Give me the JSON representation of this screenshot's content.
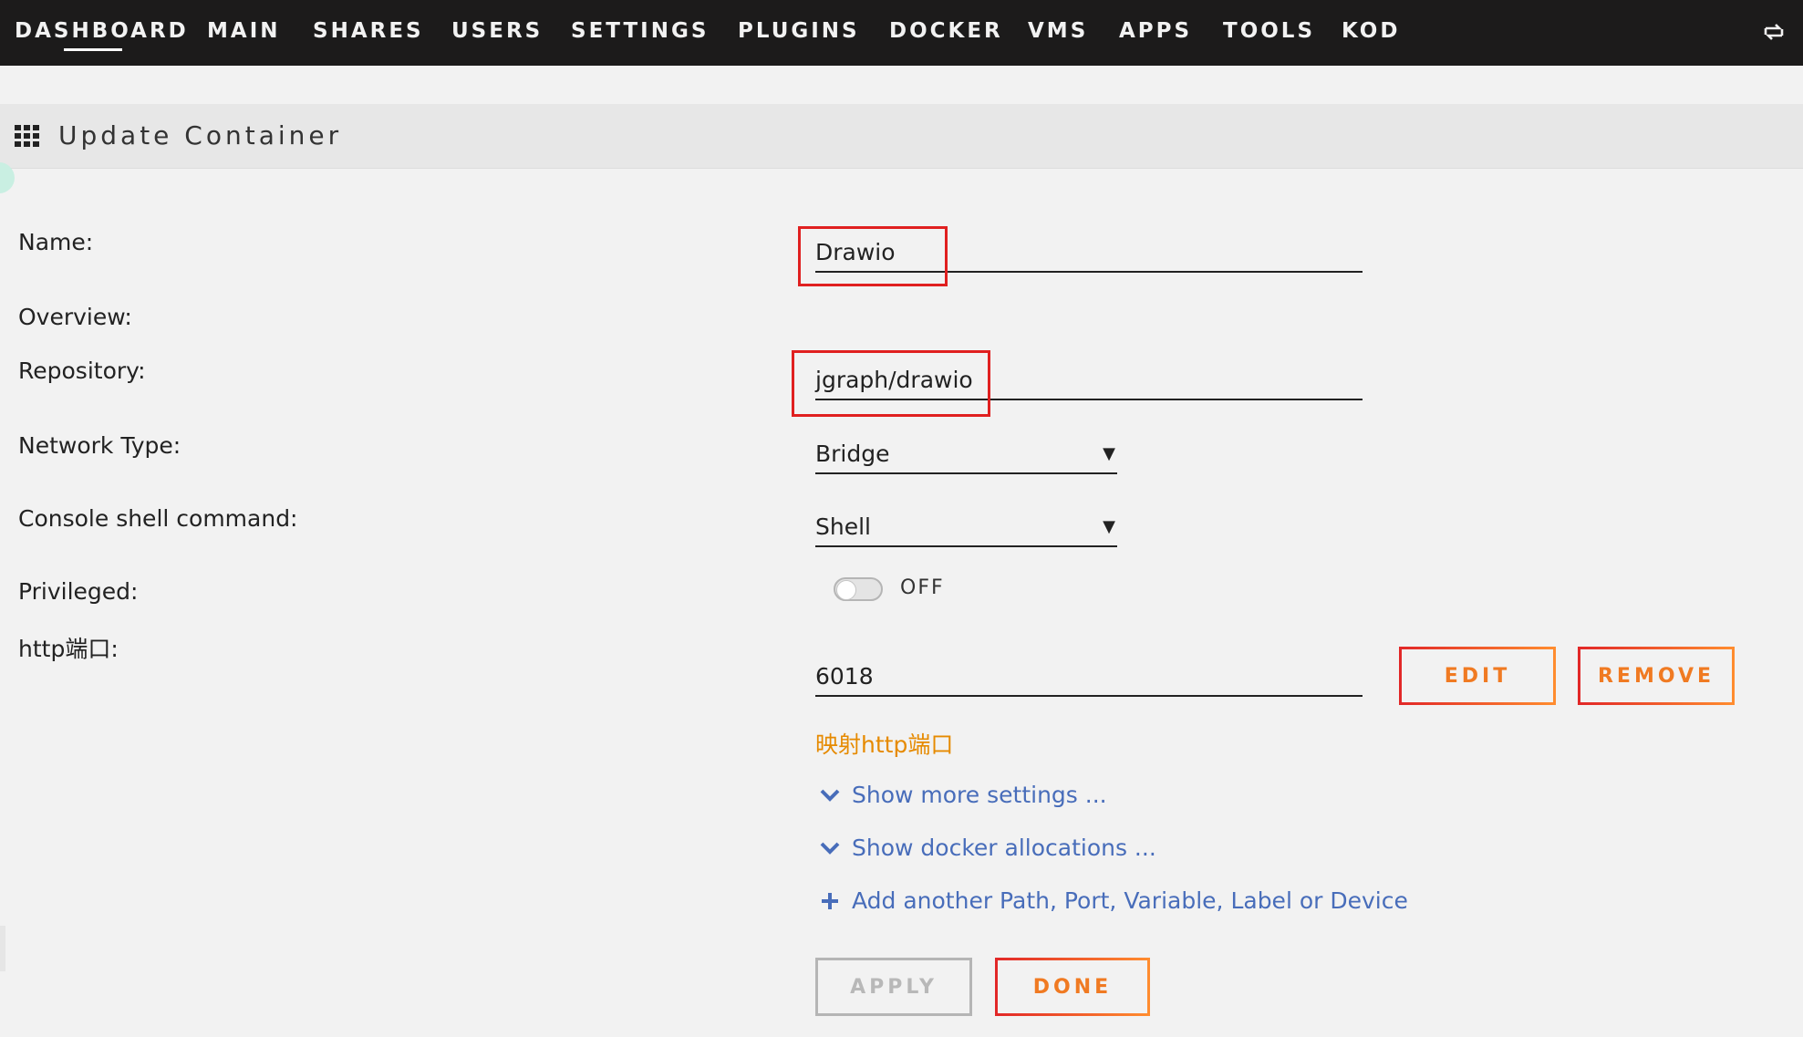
{
  "nav": {
    "items": [
      "DASHBOARD",
      "MAIN",
      "SHARES",
      "USERS",
      "SETTINGS",
      "PLUGINS",
      "DOCKER",
      "VMS",
      "APPS",
      "TOOLS",
      "KOD"
    ],
    "active": "DASHBOARD",
    "right_icon": "switch-icon"
  },
  "header": {
    "title": "Update Container",
    "icon": "grid-icon"
  },
  "form": {
    "name_label": "Name:",
    "name_value": "Drawio",
    "overview_label": "Overview:",
    "repository_label": "Repository:",
    "repository_value": "jgraph/drawio",
    "network_label": "Network Type:",
    "network_value": "Bridge",
    "console_label": "Console shell command:",
    "console_value": "Shell",
    "privileged_label": "Privileged:",
    "privileged_value": "OFF",
    "http_label": "http端口:",
    "http_value": "6018",
    "http_hint": "映射http端口",
    "edit_label": "EDIT",
    "remove_label": "REMOVE"
  },
  "links": {
    "more_settings": "Show more settings ...",
    "docker_allocations": "Show docker allocations ...",
    "add_another": "Add another Path, Port, Variable, Label or Device"
  },
  "actions": {
    "apply": "APPLY",
    "done": "DONE"
  },
  "colors": {
    "topbar": "#1c1b1b",
    "accent_orange": "#f07a22",
    "accent_red": "#e22828",
    "link_blue": "#486dba",
    "hint_orange": "#e68a00",
    "highlight_box": "#e02020"
  }
}
